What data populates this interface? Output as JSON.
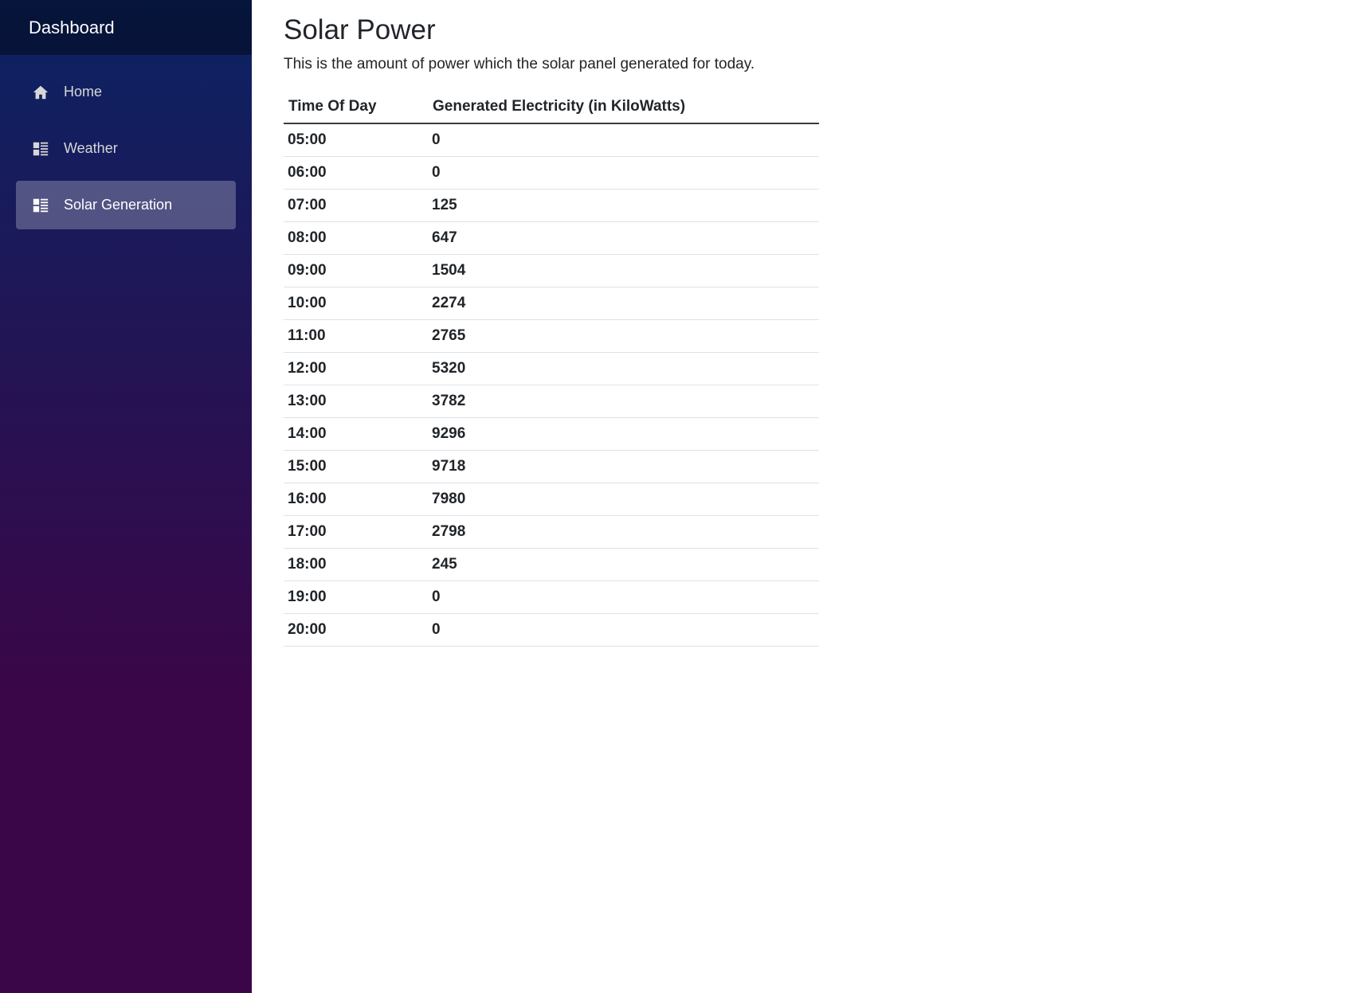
{
  "sidebar": {
    "brand": "Dashboard",
    "items": [
      {
        "label": "Home",
        "icon": "home-icon",
        "active": false
      },
      {
        "label": "Weather",
        "icon": "list-icon",
        "active": false
      },
      {
        "label": "Solar Generation",
        "icon": "list-icon",
        "active": true
      }
    ]
  },
  "main": {
    "title": "Solar Power",
    "intro": "This is the amount of power which the solar panel generated for today.",
    "table": {
      "headers": [
        "Time Of Day",
        "Generated Electricity (in KiloWatts)"
      ],
      "rows": [
        [
          "05:00",
          "0"
        ],
        [
          "06:00",
          "0"
        ],
        [
          "07:00",
          "125"
        ],
        [
          "08:00",
          "647"
        ],
        [
          "09:00",
          "1504"
        ],
        [
          "10:00",
          "2274"
        ],
        [
          "11:00",
          "2765"
        ],
        [
          "12:00",
          "5320"
        ],
        [
          "13:00",
          "3782"
        ],
        [
          "14:00",
          "9296"
        ],
        [
          "15:00",
          "9718"
        ],
        [
          "16:00",
          "7980"
        ],
        [
          "17:00",
          "2798"
        ],
        [
          "18:00",
          "245"
        ],
        [
          "19:00",
          "0"
        ],
        [
          "20:00",
          "0"
        ]
      ]
    }
  },
  "colors": {
    "sidebar_top": "#0b2363",
    "sidebar_bottom": "#3a0647",
    "active_item_bg": "rgba(255,255,255,0.25)"
  }
}
